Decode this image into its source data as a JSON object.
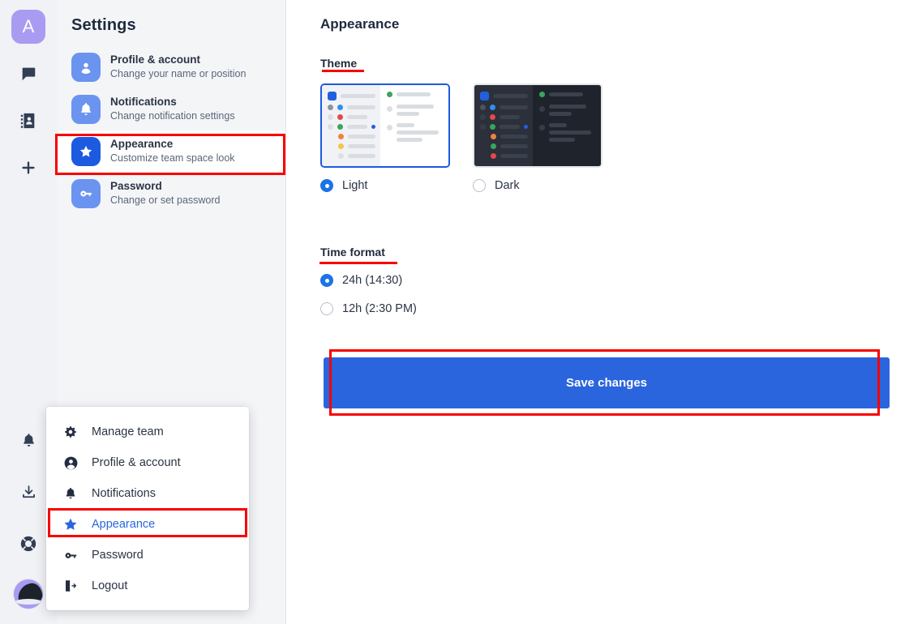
{
  "app_rail": {
    "workspace_avatar": "A",
    "icons": [
      {
        "name": "chat-icon"
      },
      {
        "name": "contacts-icon"
      },
      {
        "name": "plus-icon"
      }
    ],
    "bottom_icons": [
      {
        "name": "bell-icon"
      },
      {
        "name": "download-icon"
      },
      {
        "name": "lifebuoy-help-icon"
      }
    ],
    "user_avatar": "user-avatar"
  },
  "settings": {
    "title": "Settings",
    "items": [
      {
        "label": "Profile & account",
        "sub": "Change your name or position",
        "icon": "person-icon"
      },
      {
        "label": "Notifications",
        "sub": "Change notification settings",
        "icon": "bell-icon"
      },
      {
        "label": "Appearance",
        "sub": "Customize team space look",
        "icon": "star-icon"
      },
      {
        "label": "Password",
        "sub": "Change or set password",
        "icon": "key-icon"
      }
    ],
    "selected_index": 2
  },
  "main": {
    "page_title": "Appearance",
    "theme": {
      "section_label": "Theme",
      "options": [
        {
          "label": "Light",
          "selected": true
        },
        {
          "label": "Dark",
          "selected": false
        }
      ]
    },
    "time_format": {
      "section_label": "Time format",
      "options": [
        {
          "label": "24h (14:30)",
          "selected": true
        },
        {
          "label": "12h (2:30 PM)",
          "selected": false
        }
      ]
    },
    "save_label": "Save changes"
  },
  "context_menu": {
    "items": [
      {
        "label": "Manage team",
        "icon": "gear-icon",
        "active": false
      },
      {
        "label": "Profile & account",
        "icon": "person-icon",
        "active": false
      },
      {
        "label": "Notifications",
        "icon": "bell-icon",
        "active": false
      },
      {
        "label": "Appearance",
        "icon": "star-icon",
        "active": true
      },
      {
        "label": "Password",
        "icon": "key-icon",
        "active": false
      },
      {
        "label": "Logout",
        "icon": "logout-icon",
        "active": false
      }
    ]
  },
  "annotations": {
    "color": "#f90000",
    "marks": [
      "appearance-settings-row",
      "theme-label-underline",
      "time-format-label-underline",
      "appearance-menu-item",
      "save-changes-button"
    ]
  },
  "colors": {
    "accent_blue": "#2a65dd",
    "icon_blue": "#6b93f0",
    "selected_icon_blue": "#1c5ae0",
    "radio_blue": "#1a73e8",
    "panel_gray": "#f4f5f7",
    "rail_gray": "#f1f2f5",
    "annotation_red": "#f90000"
  }
}
